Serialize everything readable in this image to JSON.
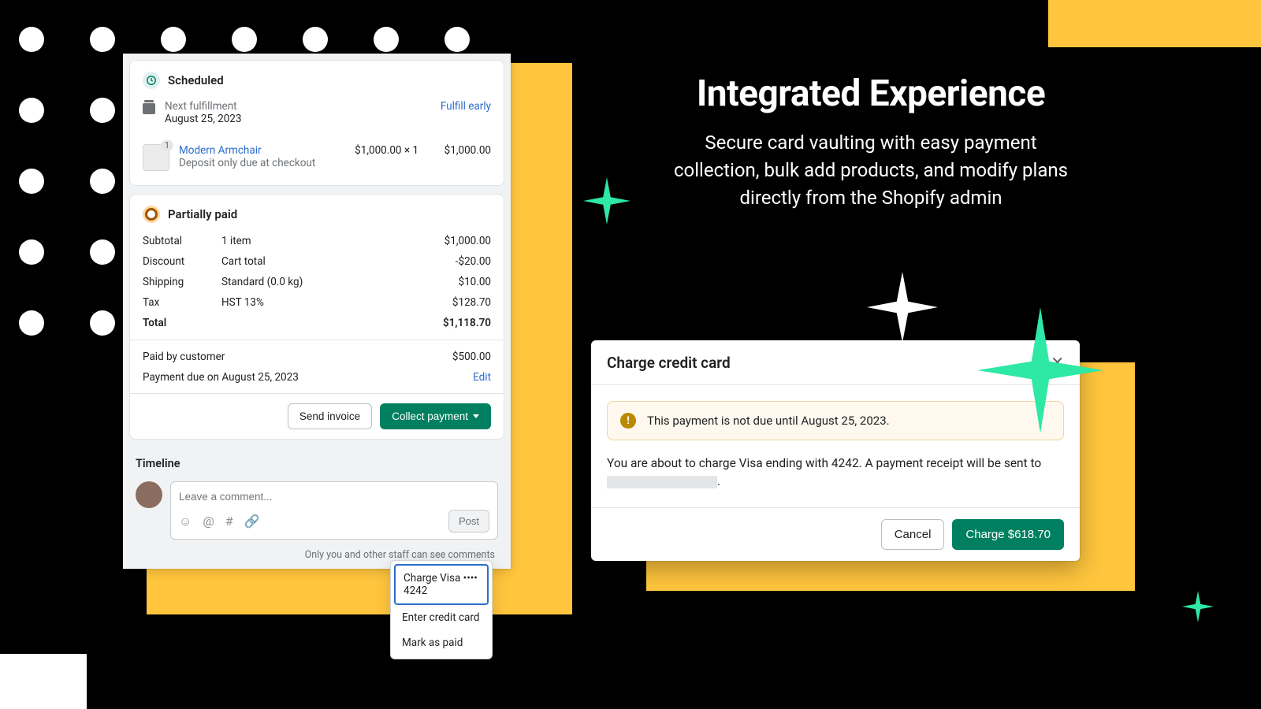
{
  "headline": {
    "title": "Integrated Experience",
    "subtitle": "Secure card vaulting with easy payment collection, bulk add products, and modify plans directly from the Shopify admin"
  },
  "order": {
    "scheduled_label": "Scheduled",
    "next_fulfillment_label": "Next fulfillment",
    "next_fulfillment_date": "August 25, 2023",
    "fulfill_early": "Fulfill early",
    "product": {
      "name": "Modern Armchair",
      "note": "Deposit only due at checkout",
      "qty_badge": "1",
      "unit": "$1,000.00 × 1",
      "line_total": "$1,000.00"
    },
    "partial_label": "Partially paid",
    "summary": {
      "subtotal_label": "Subtotal",
      "subtotal_desc": "1 item",
      "subtotal_val": "$1,000.00",
      "discount_label": "Discount",
      "discount_desc": "Cart total",
      "discount_val": "-$20.00",
      "shipping_label": "Shipping",
      "shipping_desc": "Standard (0.0 kg)",
      "shipping_val": "$10.00",
      "tax_label": "Tax",
      "tax_desc": "HST 13%",
      "tax_val": "$128.70",
      "total_label": "Total",
      "total_val": "$1,118.70",
      "paid_label": "Paid by customer",
      "paid_val": "$500.00",
      "due_label": "Payment due on August 25, 2023",
      "edit": "Edit"
    },
    "buttons": {
      "send_invoice": "Send invoice",
      "collect_payment": "Collect payment"
    },
    "dropdown": {
      "charge_card": "Charge Visa •••• 4242",
      "enter_card": "Enter credit card",
      "mark_paid": "Mark as paid"
    },
    "timeline": {
      "title": "Timeline",
      "placeholder": "Leave a comment...",
      "post": "Post",
      "note": "Only you and other staff can see comments"
    }
  },
  "modal": {
    "title": "Charge credit card",
    "banner": "This payment is not due until August 25, 2023.",
    "body_pre": "You are about to charge Visa ending with 4242. A payment receipt will be sent to ",
    "body_post": ".",
    "cancel": "Cancel",
    "charge": "Charge $618.70"
  }
}
